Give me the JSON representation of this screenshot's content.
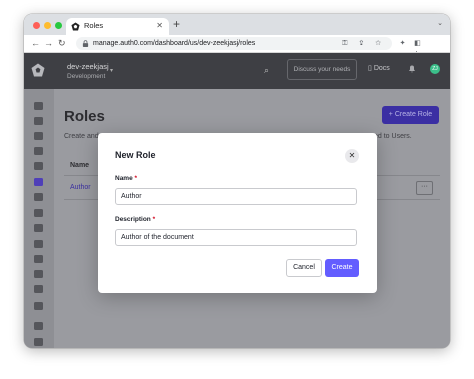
{
  "browser": {
    "tab_title": "Roles",
    "tab_close": "✕",
    "new_tab": "+",
    "tabs_menu": "⌄",
    "url": "manage.auth0.com/dashboard/us/dev-zeekjasj/roles",
    "nav": {
      "back": "←",
      "forward": "→",
      "reload": "↻"
    },
    "omnibox_icons": "⚿ ⇪ ☆",
    "toolbar_icons": {
      "extensions": "✦",
      "sidepanel": "◧",
      "menu": "⋮"
    }
  },
  "app": {
    "tenant_name": "dev-zeekjasj",
    "environment": "Development",
    "search_icon": "⌕",
    "discuss_placeholder": "Discuss your needs",
    "docs_label": "Docs",
    "bell_icon": "🔔",
    "avatar_initials": "ZJ"
  },
  "sidebar": {
    "icons": [
      "bolt-icon",
      "dashboard-icon",
      "applications-icon",
      "security-icon",
      "database-icon",
      "user-management-icon",
      "branding-icon",
      "security-shield-icon",
      "monitoring-icon",
      "actions-icon",
      "analytics-icon",
      "extensions-icon",
      "marketplace-icon",
      "settings-icon",
      "get-started-icon",
      "feedback-icon"
    ],
    "active_index": 5
  },
  "page": {
    "title": "Roles",
    "description_left": "Create and",
    "description_right": "ed to Users.",
    "create_button": "+ Create Role",
    "column_name": "Name",
    "rows": [
      {
        "name": "Author",
        "more": "···"
      }
    ]
  },
  "modal": {
    "title": "New Role",
    "close_icon": "✕",
    "name_label": "Name",
    "name_value": "Author",
    "description_label": "Description",
    "description_value": "Author of the document",
    "required_mark": "*",
    "cancel_label": "Cancel",
    "create_label": "Create"
  },
  "colors": {
    "primary": "#635dff",
    "appbar": "#3e3f44",
    "overlay": "#9a9ba0"
  }
}
